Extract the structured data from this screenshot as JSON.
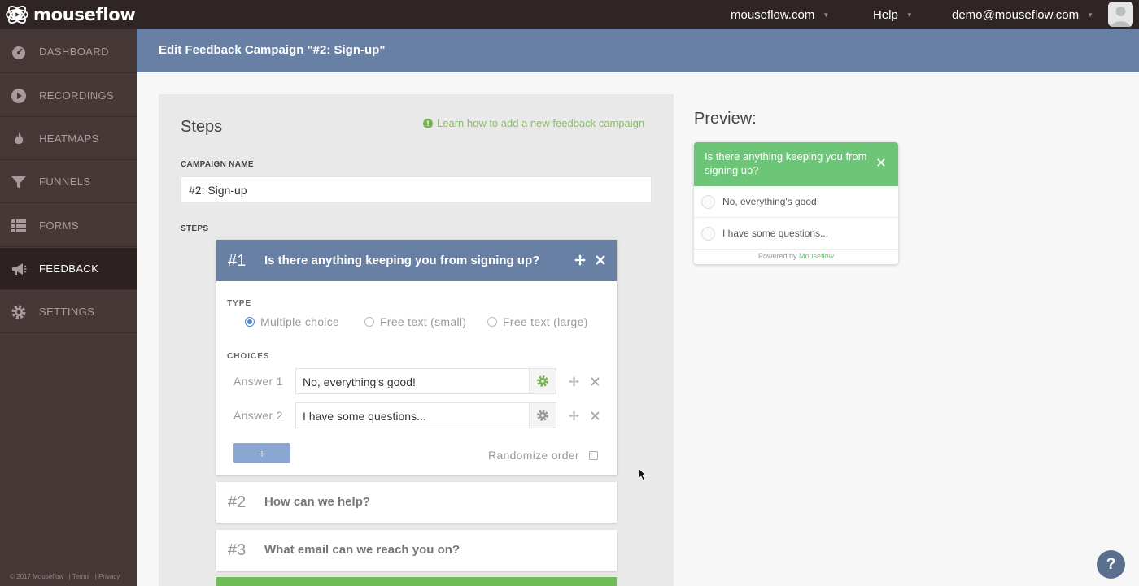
{
  "app": {
    "name": "mouseflow"
  },
  "topbar": {
    "site_menu": "mouseflow.com",
    "help_menu": "Help",
    "user_menu": "demo@mouseflow.com",
    "icons": {
      "logo": "mouseflow-logo-icon",
      "caret": "chevron-down-icon",
      "avatar": "user-avatar-icon"
    }
  },
  "sidebar": {
    "items": [
      {
        "label": "DASHBOARD",
        "icon": "dashboard-gauge-icon"
      },
      {
        "label": "RECORDINGS",
        "icon": "play-icon"
      },
      {
        "label": "HEATMAPS",
        "icon": "flame-icon"
      },
      {
        "label": "FUNNELS",
        "icon": "funnel-icon"
      },
      {
        "label": "FORMS",
        "icon": "form-list-icon"
      },
      {
        "label": "FEEDBACK",
        "icon": "megaphone-icon",
        "active": true
      },
      {
        "label": "SETTINGS",
        "icon": "gear-icon"
      }
    ],
    "footer": {
      "copyright": "© 2017 Mouseflow",
      "terms": "| Terms",
      "privacy": "| Privacy"
    }
  },
  "header": {
    "title": "Edit Feedback Campaign \"#2: Sign-up\""
  },
  "steps_panel": {
    "title": "Steps",
    "learn_link": "Learn how to add a new feedback campaign",
    "campaign_name_label": "CAMPAIGN NAME",
    "campaign_name_value": "#2: Sign-up",
    "steps_label": "STEPS",
    "active_step": {
      "number": "#1",
      "question": "Is there anything keeping you from signing up?",
      "type_label": "TYPE",
      "types": [
        "Multiple choice",
        "Free text (small)",
        "Free text (large)"
      ],
      "selected_type": "Multiple choice",
      "choices_label": "CHOICES",
      "answers": [
        {
          "label": "Answer 1",
          "value": "No, everything's good!",
          "gear_color": "#7ab553"
        },
        {
          "label": "Answer 2",
          "value": "I have some questions...",
          "gear_color": "#999999"
        }
      ],
      "add_button": "+",
      "randomize_label": "Randomize order",
      "randomize_checked": false
    },
    "other_steps": [
      {
        "number": "#2",
        "question": "How can we help?"
      },
      {
        "number": "#3",
        "question": "What email can we reach you on?"
      }
    ]
  },
  "preview": {
    "title": "Preview:",
    "question": "Is there anything keeping you from signing up?",
    "options": [
      "No, everything's good!",
      "I have some questions..."
    ],
    "powered_by": "Powered by",
    "brand": "Mouseflow"
  },
  "help_fab": "?",
  "colors": {
    "topbar": "#2f2524",
    "sidebar": "#463837",
    "accent_blue": "#6980a5",
    "accent_green": "#6dc678",
    "link_green": "#88c064"
  }
}
